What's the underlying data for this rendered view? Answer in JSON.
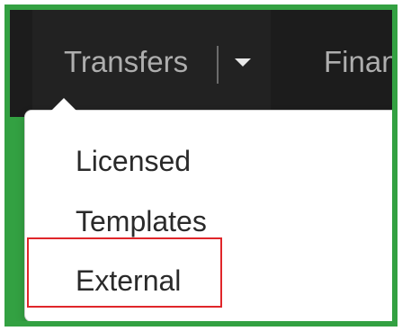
{
  "navbar": {
    "transfers_label": "Transfers",
    "finance_label": "Finan",
    "caret_icon": "caret-down-icon"
  },
  "dropdown": {
    "items": [
      {
        "label": "Licensed"
      },
      {
        "label": "Templates"
      },
      {
        "label": "External"
      }
    ]
  },
  "colors": {
    "frame_border": "#33a142",
    "navbar_bg": "#1c1c1c",
    "highlight": "#e0262a"
  }
}
